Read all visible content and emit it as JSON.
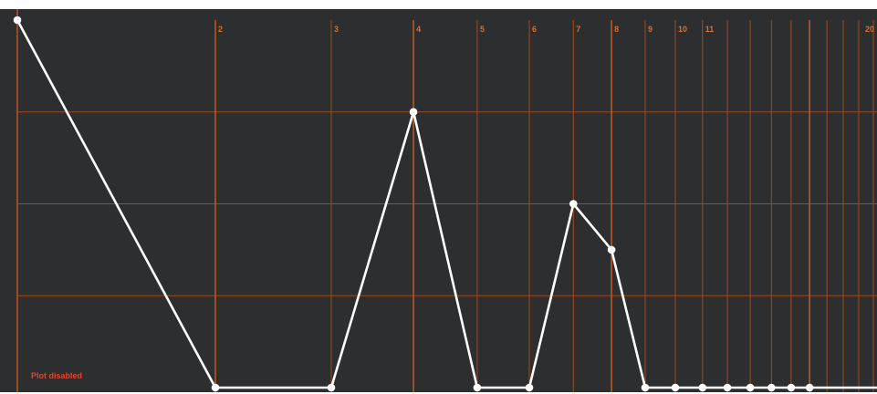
{
  "status_text": "Plot disabled",
  "colors": {
    "background": "#2d2e2f",
    "grid": "#a24a1c",
    "grid_major": "#c4581f",
    "label": "#d8702f",
    "line": "#ffffff",
    "status": "#e0452d"
  },
  "chart_data": {
    "type": "line",
    "x_scale": "log",
    "xlim": [
      1,
      20
    ],
    "ylim": [
      0,
      1
    ],
    "grid": true,
    "x_tick_labels": [
      {
        "x": 2,
        "label": "2"
      },
      {
        "x": 3,
        "label": "3"
      },
      {
        "x": 4,
        "label": "4"
      },
      {
        "x": 5,
        "label": "5"
      },
      {
        "x": 6,
        "label": "6"
      },
      {
        "x": 7,
        "label": "7"
      },
      {
        "x": 8,
        "label": "8"
      },
      {
        "x": 9,
        "label": "9"
      },
      {
        "x": 10,
        "label": "10"
      },
      {
        "x": 11,
        "label": "11"
      },
      {
        "x": 20,
        "label": "20"
      }
    ],
    "extra_gridlines_x": [
      12,
      13,
      14,
      15,
      16,
      17,
      18,
      19
    ],
    "major_gridlines_x": [
      2,
      4,
      8,
      16
    ],
    "y_gridlines": [
      0.25,
      0.5,
      0.75
    ],
    "series": [
      {
        "points": [
          {
            "x": 1,
            "y": 1.0
          },
          {
            "x": 2,
            "y": 0.0
          },
          {
            "x": 3,
            "y": 0.0
          },
          {
            "x": 4,
            "y": 0.75
          },
          {
            "x": 5,
            "y": 0.0
          },
          {
            "x": 6,
            "y": 0.0
          },
          {
            "x": 7,
            "y": 0.5
          },
          {
            "x": 8,
            "y": 0.375
          },
          {
            "x": 9,
            "y": 0.0
          },
          {
            "x": 10,
            "y": 0.0
          },
          {
            "x": 11,
            "y": 0.0
          },
          {
            "x": 12,
            "y": 0.0
          },
          {
            "x": 13,
            "y": 0.0
          },
          {
            "x": 14,
            "y": 0.0
          },
          {
            "x": 15,
            "y": 0.0
          },
          {
            "x": 16,
            "y": 0.0
          }
        ]
      }
    ]
  }
}
